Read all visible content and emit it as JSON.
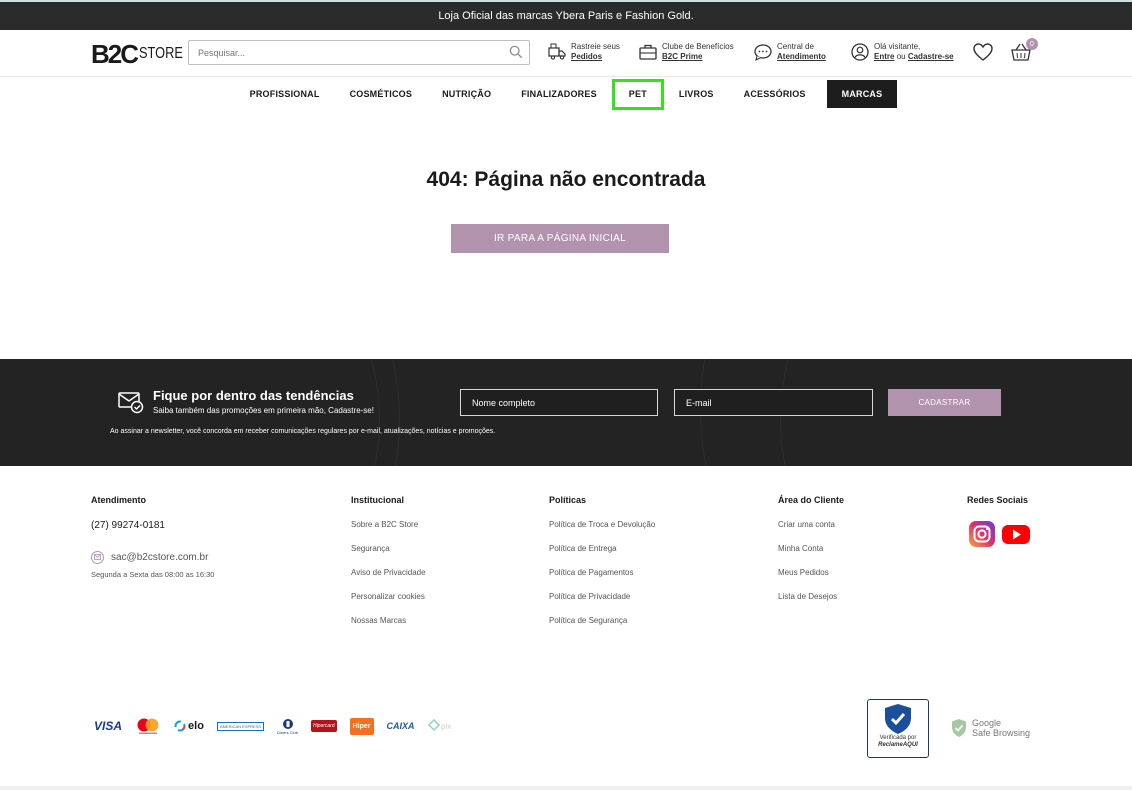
{
  "announcement": "Loja Oficial das marcas Ybera Paris e Fashion Gold.",
  "logo": {
    "b2c": "B2C",
    "store": "STORE"
  },
  "search": {
    "placeholder": "Pesquisar..."
  },
  "header_links": {
    "track": {
      "line1": "Rastreie seus",
      "line2": "Pedidos"
    },
    "club": {
      "line1": "Clube de Benefícios",
      "line2": "B2C Prime"
    },
    "support": {
      "line1": "Central de",
      "line2": "Atendimento"
    },
    "account": {
      "line1": "Olá visitante,",
      "login": "Entre",
      "or": "ou",
      "register": "Cadastre-se"
    }
  },
  "cart": {
    "count": "0"
  },
  "nav": {
    "profissional": "PROFISSIONAL",
    "cosmeticos": "COSMÉTICOS",
    "nutricao": "NUTRIÇÃO",
    "finalizadores": "FINALIZADORES",
    "pet": "PET",
    "livros": "LIVROS",
    "acessorios": "ACESSÓRIOS",
    "marcas": "MARCAS"
  },
  "error": {
    "title": "404: Página não encontrada",
    "button": "IR PARA A PÁGINA INICIAL"
  },
  "newsletter": {
    "title": "Fique por dentro das tendências",
    "subtitle": "Saiba também das promoções em primeira mão, Cadastre-se!",
    "disclaimer": "Ao assinar a newsletter, você concorda em receber comunicações regulares por e-mail, atualizações, notícias e promoções.",
    "name_placeholder": "Nome completo",
    "email_placeholder": "E-mail",
    "button": "CADASTRAR"
  },
  "footer": {
    "atendimento": {
      "title": "Atendimento",
      "phone": "(27) 99274-0181",
      "email": "sac@b2cstore.com.br",
      "hours": "Segunda a Sexta das 08:00 as 16:30"
    },
    "institucional": {
      "title": "Institucional",
      "links": [
        "Sobre a B2C Store",
        "Segurança",
        "Aviso de Privacidade",
        "Personalizar cookies",
        "Nossas Marcas"
      ]
    },
    "politicas": {
      "title": "Políticas",
      "links": [
        "Política de Troca e Devolução",
        "Política de Entrega",
        "Política de Pagamentos",
        "Política de Privacidade",
        "Política de Segurança"
      ]
    },
    "cliente": {
      "title": "Área do Cliente",
      "links": [
        "Criar uma conta",
        "Minha Conta",
        "Meus Pedidos",
        "Lista de Desejos"
      ]
    },
    "social": {
      "title": "Redes Sociais"
    }
  },
  "payments": {
    "visa": "VISA",
    "elo": "elo",
    "amex": "AMERICAN EXPRESS",
    "diners": "Diners Club",
    "hipercard": "Hipercard",
    "hiper": "Hiper",
    "caixa": "CAIXA"
  },
  "seals": {
    "reclame_line1": "Verificada por",
    "reclame_line2": "ReclameAQUI",
    "google_line1": "Google",
    "google_line2": "Safe Browsing"
  },
  "colors": {
    "accent": "#b293ae",
    "dark": "#232323",
    "highlight": "#35e01f"
  }
}
